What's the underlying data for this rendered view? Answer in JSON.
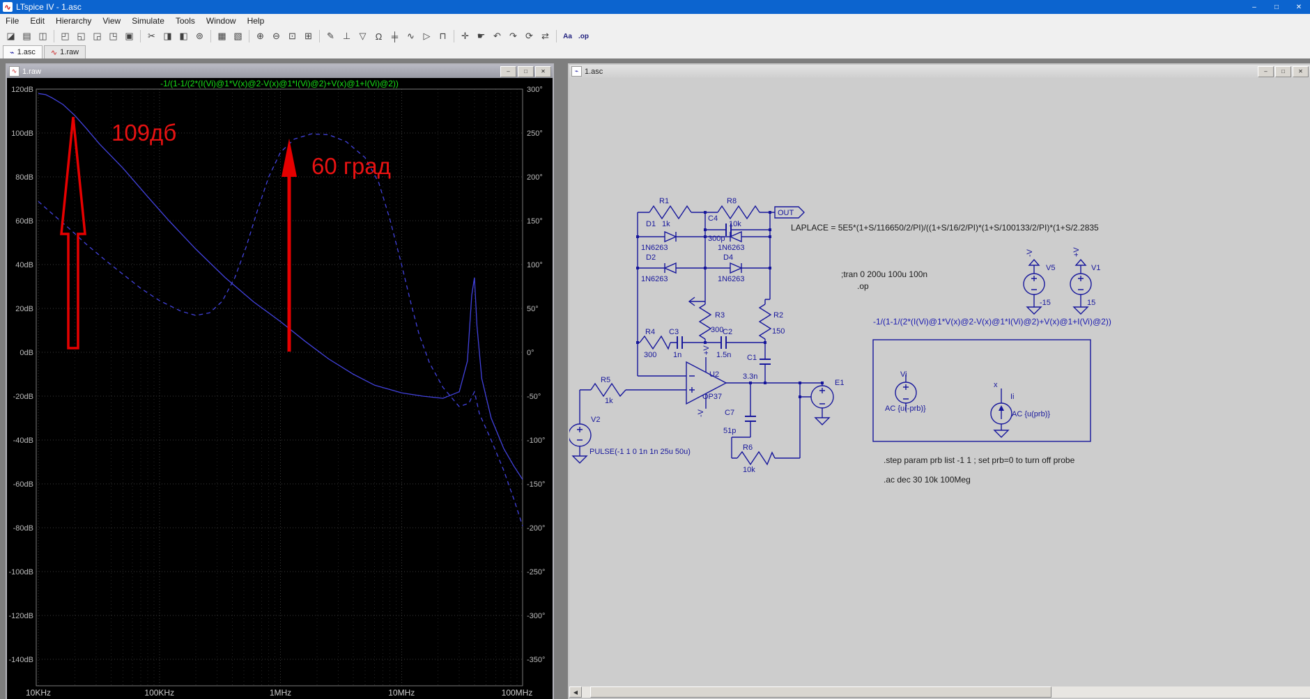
{
  "app": {
    "title": "LTspice IV - 1.asc",
    "window_buttons": {
      "minimize": "–",
      "maximize": "□",
      "close": "✕"
    },
    "logo_glyph": "∿"
  },
  "menu": {
    "items": [
      "File",
      "Edit",
      "Hierarchy",
      "View",
      "Simulate",
      "Tools",
      "Window",
      "Help"
    ]
  },
  "toolbar": {
    "buttons": [
      {
        "name": "new-schematic",
        "glyph": "◪"
      },
      {
        "name": "open",
        "glyph": "▤"
      },
      {
        "name": "save",
        "glyph": "◫"
      },
      {
        "sep": true
      },
      {
        "name": "cascade-windows",
        "glyph": "◰"
      },
      {
        "name": "tile-horizontal",
        "glyph": "◱"
      },
      {
        "name": "tile-vertical",
        "glyph": "◲"
      },
      {
        "name": "zoom-window",
        "glyph": "◳"
      },
      {
        "name": "close-window",
        "glyph": "▣"
      },
      {
        "sep": true
      },
      {
        "name": "cut",
        "glyph": "✂"
      },
      {
        "name": "copy",
        "glyph": "◨"
      },
      {
        "name": "paste",
        "glyph": "◧"
      },
      {
        "name": "find",
        "glyph": "⊚"
      },
      {
        "sep": true
      },
      {
        "name": "print",
        "glyph": "▦"
      },
      {
        "name": "print-preview",
        "glyph": "▧"
      },
      {
        "sep": true
      },
      {
        "name": "zoom-in",
        "glyph": "⊕"
      },
      {
        "name": "zoom-out",
        "glyph": "⊖"
      },
      {
        "name": "zoom-full-extents",
        "glyph": "⊡"
      },
      {
        "name": "pan",
        "glyph": "⊞"
      },
      {
        "sep": true
      },
      {
        "name": "wire",
        "glyph": "✎"
      },
      {
        "name": "ground",
        "glyph": "⊥"
      },
      {
        "name": "net-label",
        "glyph": "▽"
      },
      {
        "name": "resistor",
        "glyph": "Ω"
      },
      {
        "name": "capacitor",
        "glyph": "╪"
      },
      {
        "name": "inductor",
        "glyph": "∿"
      },
      {
        "name": "diode",
        "glyph": "▷"
      },
      {
        "name": "component",
        "glyph": "⊓"
      },
      {
        "sep": true
      },
      {
        "name": "move",
        "glyph": "✛"
      },
      {
        "name": "drag",
        "glyph": "☛"
      },
      {
        "name": "undo",
        "glyph": "↶"
      },
      {
        "name": "redo",
        "glyph": "↷"
      },
      {
        "name": "rotate",
        "glyph": "⟳"
      },
      {
        "name": "mirror",
        "glyph": "⇄"
      },
      {
        "sep": true
      },
      {
        "name": "text",
        "glyph": "Aa",
        "text_style": true
      },
      {
        "name": "spice-directive",
        "glyph": ".op",
        "text_style": true
      }
    ]
  },
  "tabs": [
    {
      "label": "1.asc",
      "icon": "⌁"
    },
    {
      "label": "1.raw",
      "icon": "∿"
    }
  ],
  "plot_window": {
    "title": "1.raw",
    "buttons": {
      "minimize": "–",
      "maximize": "□",
      "close": "✕"
    }
  },
  "schematic_window": {
    "title": "1.asc",
    "buttons": {
      "minimize": "–",
      "maximize": "□",
      "close": "✕"
    }
  },
  "chart_data": {
    "type": "line",
    "title": "-1/(1-1/(2*(I(Vi)@1*V(x)@2-V(x)@1*I(Vi)@2)+V(x)@1+I(Vi)@2))",
    "x_axis": {
      "scale": "log",
      "min_hz": 10000,
      "max_hz": 100000000,
      "tick_labels": [
        "10KHz",
        "100KHz",
        "1MHz",
        "10MHz",
        "100MHz"
      ]
    },
    "y_left": {
      "unit": "dB",
      "top_value": 120,
      "div_value": 20,
      "tick_labels": [
        "120dB",
        "100dB",
        "80dB",
        "60dB",
        "40dB",
        "20dB",
        "0dB",
        "-20dB",
        "-40dB",
        "-60dB",
        "-80dB",
        "-100dB",
        "-120dB",
        "-140dB"
      ]
    },
    "y_right": {
      "unit": "deg",
      "top_value": 300,
      "div_value": 50,
      "tick_labels": [
        "300°",
        "250°",
        "200°",
        "150°",
        "100°",
        "50°",
        "0°",
        "-50°",
        "-100°",
        "-150°",
        "-200°",
        "-250°",
        "-300°",
        "-350°"
      ]
    },
    "grid": true,
    "series": [
      {
        "name": "gain",
        "axis": "left",
        "line_style": "solid",
        "points": [
          [
            10000,
            118
          ],
          [
            11500,
            117.5
          ],
          [
            13000,
            116
          ],
          [
            16000,
            113
          ],
          [
            20000,
            108
          ],
          [
            25000,
            102
          ],
          [
            32000,
            95
          ],
          [
            50000,
            84
          ],
          [
            80000,
            71
          ],
          [
            120000,
            60
          ],
          [
            200000,
            47
          ],
          [
            350000,
            34
          ],
          [
            600000,
            23
          ],
          [
            1000000,
            14
          ],
          [
            1600000,
            5
          ],
          [
            2500000,
            -3
          ],
          [
            4000000,
            -10
          ],
          [
            6000000,
            -15
          ],
          [
            10000000,
            -18.5
          ],
          [
            15000000,
            -20
          ],
          [
            22000000,
            -21
          ],
          [
            30000000,
            -18
          ],
          [
            35000000,
            -4
          ],
          [
            38000000,
            26
          ],
          [
            40000000,
            34
          ],
          [
            42000000,
            12
          ],
          [
            46000000,
            -12
          ],
          [
            55000000,
            -30
          ],
          [
            70000000,
            -44
          ],
          [
            85000000,
            -52
          ],
          [
            100000000,
            -58
          ]
        ]
      },
      {
        "name": "phase",
        "axis": "right",
        "line_style": "dashed",
        "points": [
          [
            10000,
            172
          ],
          [
            13000,
            158
          ],
          [
            18000,
            141
          ],
          [
            25000,
            123
          ],
          [
            35000,
            106
          ],
          [
            50000,
            89
          ],
          [
            70000,
            73
          ],
          [
            100000,
            59
          ],
          [
            150000,
            47
          ],
          [
            200000,
            42
          ],
          [
            260000,
            45
          ],
          [
            330000,
            58
          ],
          [
            420000,
            85
          ],
          [
            520000,
            120
          ],
          [
            650000,
            163
          ],
          [
            800000,
            200
          ],
          [
            1000000,
            228
          ],
          [
            1300000,
            243
          ],
          [
            1800000,
            249
          ],
          [
            2500000,
            248
          ],
          [
            3500000,
            240
          ],
          [
            5000000,
            222
          ],
          [
            6500000,
            193
          ],
          [
            8000000,
            152
          ],
          [
            10000000,
            100
          ],
          [
            12000000,
            55
          ],
          [
            14000000,
            20
          ],
          [
            17000000,
            -12
          ],
          [
            22000000,
            -40
          ],
          [
            30000000,
            -62
          ],
          [
            36000000,
            -58
          ],
          [
            40000000,
            -45
          ],
          [
            44000000,
            -70
          ],
          [
            55000000,
            -100
          ],
          [
            70000000,
            -135
          ],
          [
            85000000,
            -168
          ],
          [
            100000000,
            -198
          ]
        ]
      }
    ],
    "annotations": [
      {
        "text": "109дб",
        "meaning": "gain marker at low frequency"
      },
      {
        "text": "60 град",
        "meaning": "phase margin marker near 1MHz"
      }
    ]
  },
  "schematic": {
    "labels": {
      "r1_name": "R1",
      "r1_value": "1k",
      "r8_name": "R8",
      "r8_value": "10k",
      "c4_name": "C4",
      "c4_value": "300p",
      "d1_name": "D1",
      "d1_value": "1N6263",
      "d2_name": "D2",
      "d2_value": "1N6263",
      "d3_value": "1N6263",
      "d4_name": "D4",
      "d4_value": "1N6263",
      "out_flag": "OUT",
      "r3_name": "R3",
      "r3_value": "300",
      "r2_name": "R2",
      "r2_value": "150",
      "r4_name": "R4",
      "r4_value": "300",
      "c3_name": "C3",
      "c3_value": "1n",
      "c2_name": "C2",
      "c2_value": "1.5n",
      "c1_name": "C1",
      "c1_value": "3.3n",
      "u2_name": "U2",
      "u2_value": "OP37",
      "r5_name": "R5",
      "r5_value": "1k",
      "v2_name": "V2",
      "v2_value": "PULSE(-1 1 0 1n 1n 25u 50u)",
      "c7_name": "C7",
      "c7_value": "51p",
      "r6_name": "R6",
      "r6_value": "10k",
      "e1_name": "E1",
      "vi_name": "Vi",
      "vi_value": "AC {u(-prb)}",
      "ii_name": "Ii",
      "ii_value": "AC {u(prb)}",
      "x_net": "x",
      "v5_name": "V5",
      "v5_value": "-15",
      "v1_name": "V1",
      "v1_value": "15",
      "plus_v": "+V",
      "minus_v": "-V"
    },
    "directives": {
      "laplace": "LAPLACE = 5E5*(1+S/116650/2/PI)/((1+S/16/2/PI)*(1+S/100133/2/PI)*(1+S/2.2835",
      "tran_comment": ";tran 0 200u 100u 100n",
      "op": ".op",
      "expression": "-1/(1-1/(2*(I(Vi)@1*V(x)@2-V(x)@1*I(Vi)@2)+V(x)@1+I(Vi)@2))",
      "step": ".step param prb list -1 1 ; set prb=0 to turn off probe",
      "ac": ".ac dec 30 10k 100Meg"
    }
  }
}
